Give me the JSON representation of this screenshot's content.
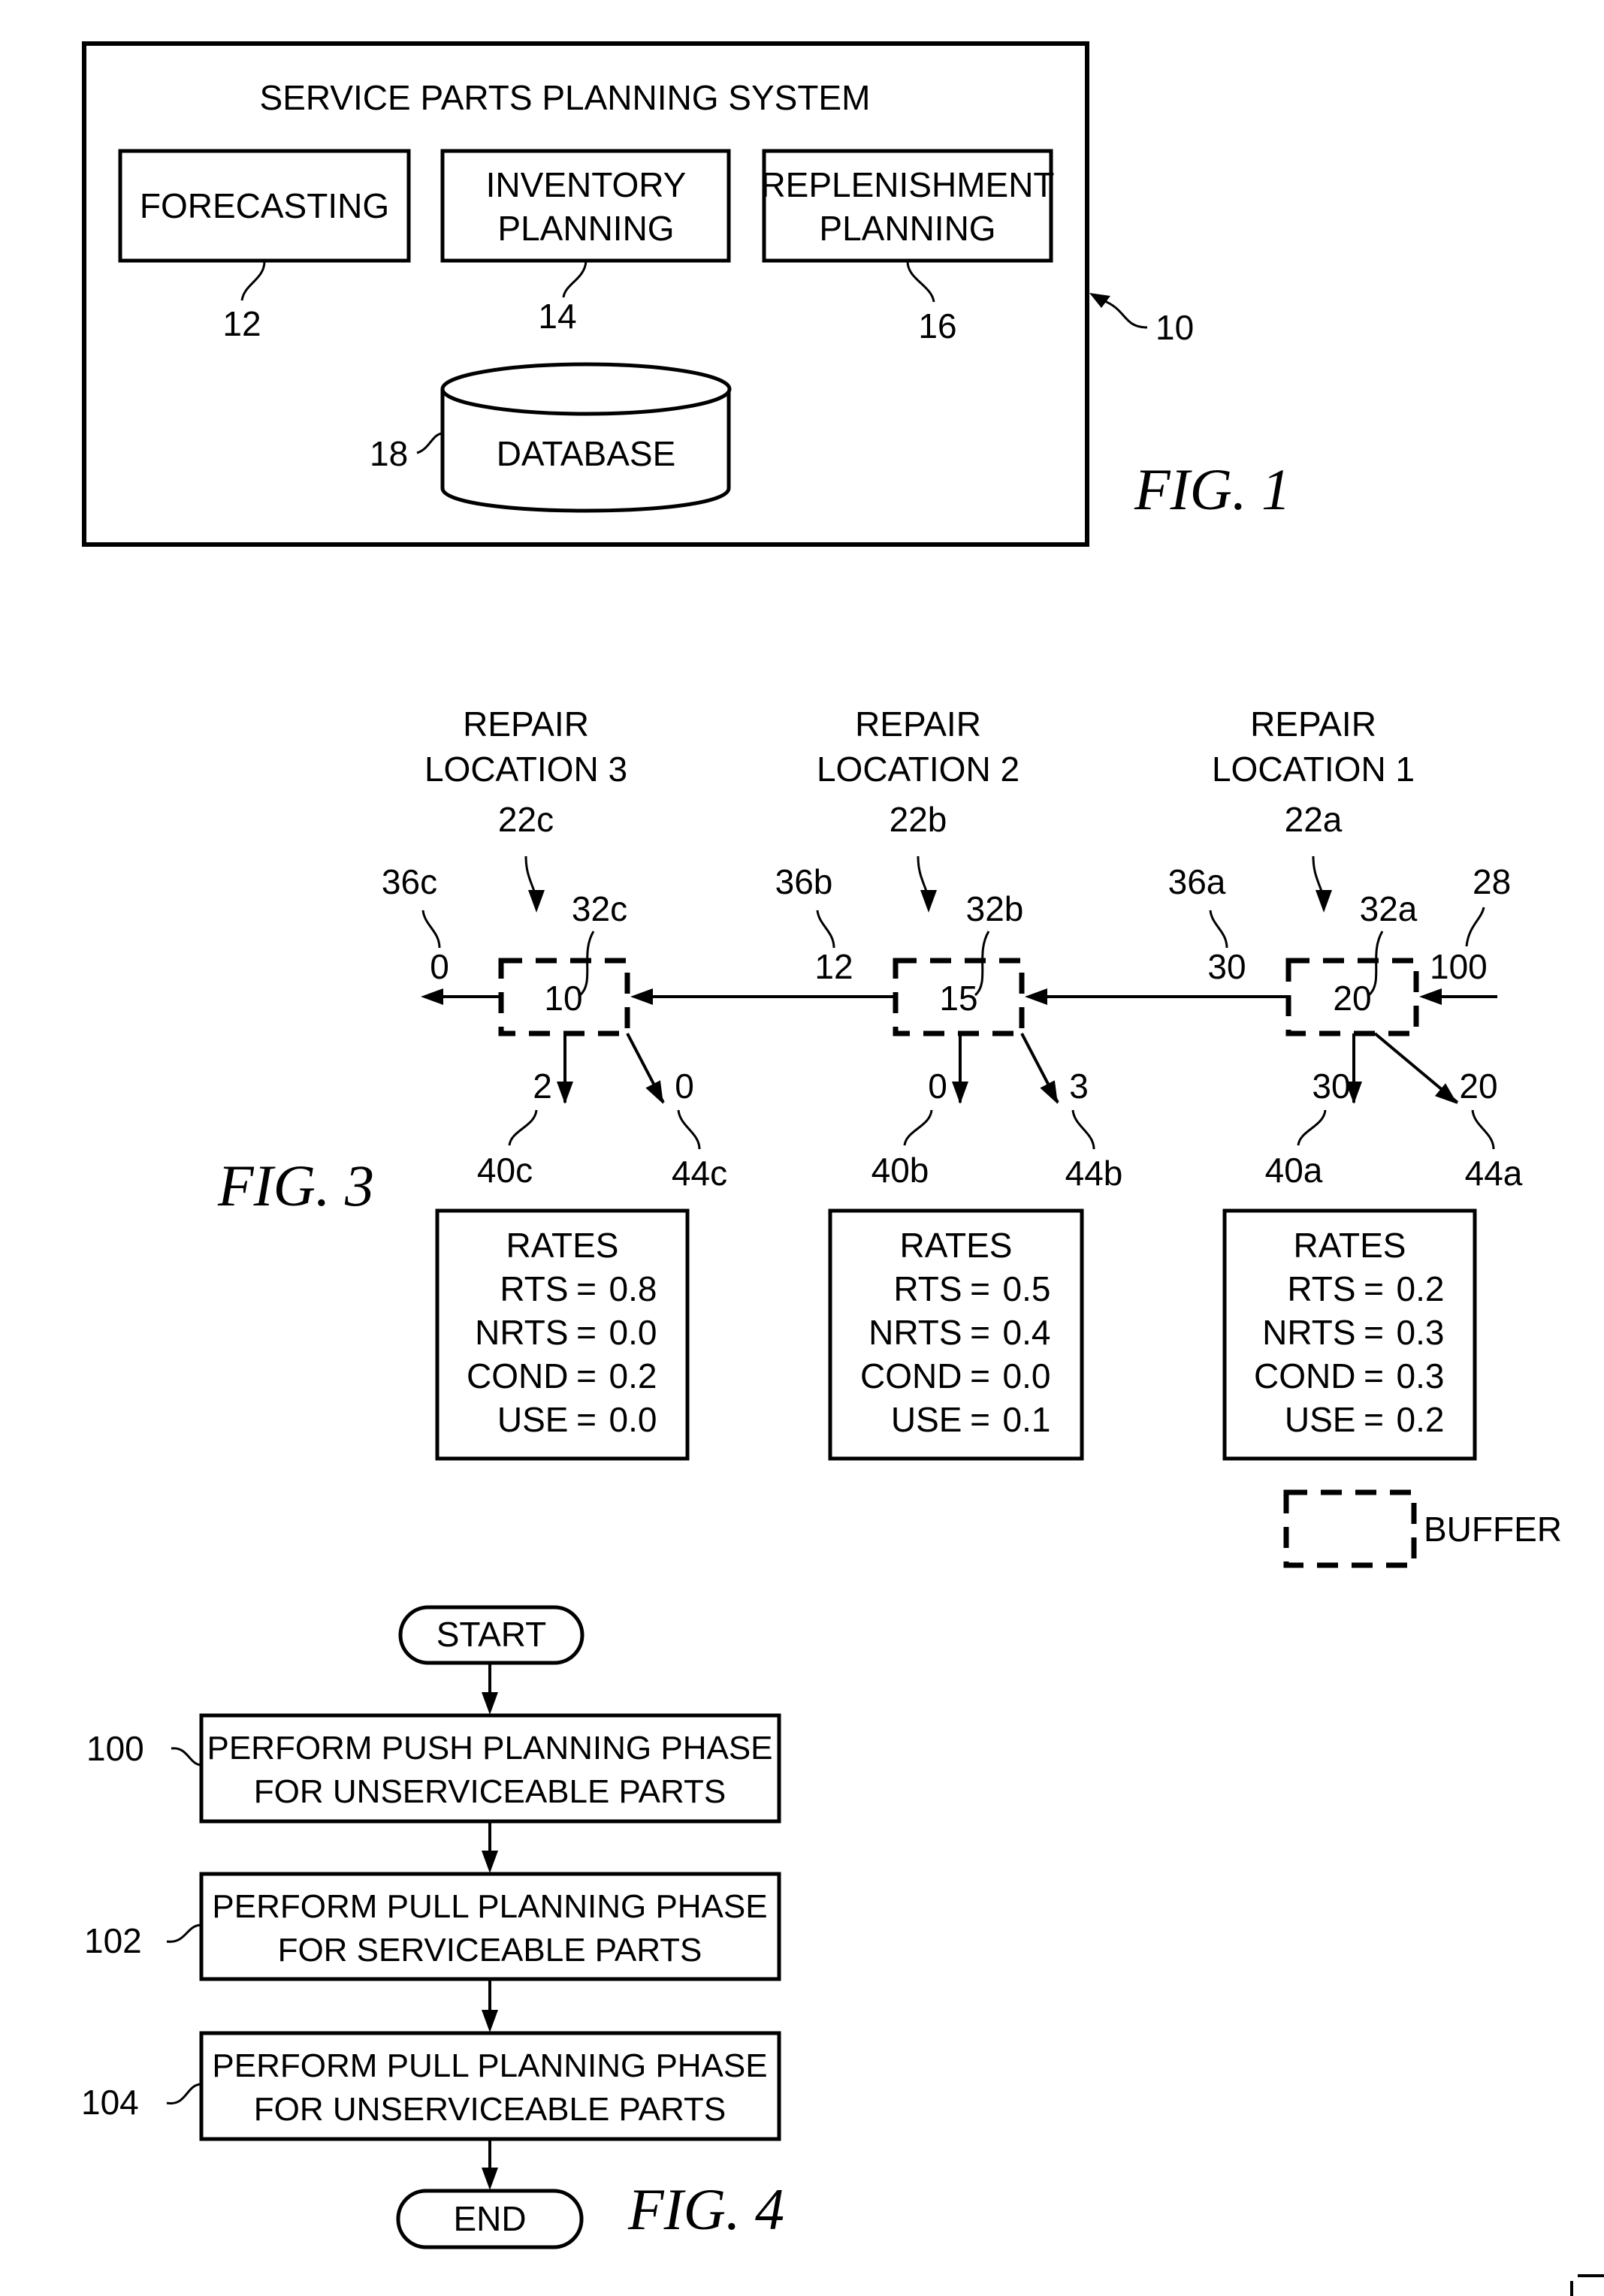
{
  "fig1": {
    "caption": "FIG. 1",
    "system_title": "SERVICE PARTS PLANNING SYSTEM",
    "system_ref": "10",
    "modules": [
      {
        "lines": [
          "FORECASTING"
        ],
        "ref": "12"
      },
      {
        "lines": [
          "INVENTORY",
          "PLANNING"
        ],
        "ref": "14"
      },
      {
        "lines": [
          "REPLENISHMENT",
          "PLANNING"
        ],
        "ref": "16"
      }
    ],
    "database": {
      "label": "DATABASE",
      "ref": "18"
    }
  },
  "fig3": {
    "caption": "FIG. 3",
    "inflow": {
      "value": "100",
      "ref": "28"
    },
    "locations": [
      {
        "title_lines": [
          "REPAIR",
          "LOCATION 3"
        ],
        "ref": "22c",
        "buffer_value": "10",
        "buffer_ref": "32c",
        "outflow_value": "0",
        "outflow_ref": "36c",
        "down_value": "2",
        "down_ref": "40c",
        "diag_value": "0",
        "diag_ref": "44c",
        "rates": {
          "title": "RATES",
          "rows": [
            {
              "name": "RTS",
              "value": "0.8"
            },
            {
              "name": "NRTS",
              "value": "0.0"
            },
            {
              "name": "COND",
              "value": "0.2"
            },
            {
              "name": "USE",
              "value": "0.0"
            }
          ]
        }
      },
      {
        "title_lines": [
          "REPAIR",
          "LOCATION 2"
        ],
        "ref": "22b",
        "buffer_value": "15",
        "buffer_ref": "32b",
        "outflow_value": "12",
        "outflow_ref": "36b",
        "down_value": "0",
        "down_ref": "40b",
        "diag_value": "3",
        "diag_ref": "44b",
        "rates": {
          "title": "RATES",
          "rows": [
            {
              "name": "RTS",
              "value": "0.5"
            },
            {
              "name": "NRTS",
              "value": "0.4"
            },
            {
              "name": "COND",
              "value": "0.0"
            },
            {
              "name": "USE",
              "value": "0.1"
            }
          ]
        }
      },
      {
        "title_lines": [
          "REPAIR",
          "LOCATION 1"
        ],
        "ref": "22a",
        "buffer_value": "20",
        "buffer_ref": "32a",
        "outflow_value": "30",
        "outflow_ref": "36a",
        "down_value": "30",
        "down_ref": "40a",
        "diag_value": "20",
        "diag_ref": "44a",
        "rates": {
          "title": "RATES",
          "rows": [
            {
              "name": "RTS",
              "value": "0.2"
            },
            {
              "name": "NRTS",
              "value": "0.3"
            },
            {
              "name": "COND",
              "value": "0.3"
            },
            {
              "name": "USE",
              "value": "0.2"
            }
          ]
        }
      }
    ],
    "legend": {
      "label": "BUFFER"
    }
  },
  "fig4": {
    "caption": "FIG. 4",
    "start": "START",
    "end": "END",
    "steps": [
      {
        "ref": "100",
        "lines": [
          "PERFORM PUSH PLANNING PHASE",
          "FOR UNSERVICEABLE PARTS"
        ]
      },
      {
        "ref": "102",
        "lines": [
          "PERFORM PULL PLANNING PHASE",
          "FOR SERVICEABLE PARTS"
        ]
      },
      {
        "ref": "104",
        "lines": [
          "PERFORM PULL PLANNING PHASE",
          "FOR UNSERVICEABLE PARTS"
        ]
      }
    ]
  }
}
